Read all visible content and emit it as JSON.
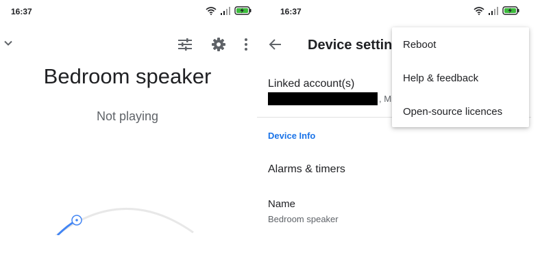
{
  "left": {
    "status_bar": {
      "time": "16:37"
    },
    "device_name": "Bedroom speaker",
    "playback_status": "Not playing"
  },
  "right": {
    "status_bar": {
      "time": "16:37"
    },
    "title": "Device setting",
    "linked_accounts": {
      "label": "Linked account(s)",
      "suffix": ", Mi"
    },
    "section_header": "Device Info",
    "alarms": "Alarms & timers",
    "name": {
      "label": "Name",
      "value": "Bedroom speaker"
    }
  },
  "menu": {
    "items": [
      "Reboot",
      "Help & feedback",
      "Open-source licences"
    ]
  },
  "colors": {
    "accent": "#1a73e8",
    "icon": "#5f6368",
    "battery": "#3cba3c"
  },
  "icons": [
    "wifi-icon",
    "signal-icon",
    "battery-icon",
    "chevron-down-icon",
    "equalizer-icon",
    "gear-icon",
    "more-vert-icon",
    "back-arrow-icon"
  ]
}
